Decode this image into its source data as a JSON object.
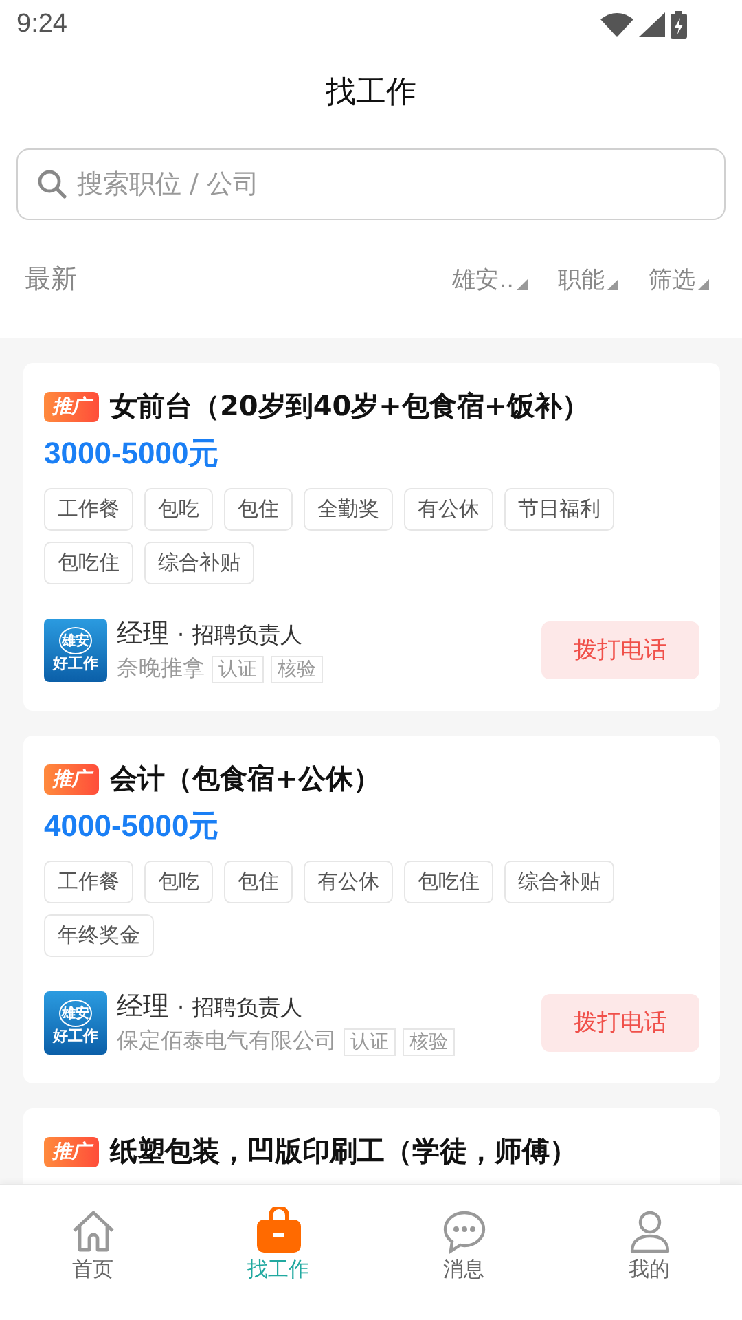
{
  "status_bar": {
    "time": "9:24"
  },
  "header": {
    "title": "找工作"
  },
  "search": {
    "placeholder": "搜索职位 / 公司"
  },
  "filters": {
    "sort": "最新",
    "dropdowns": [
      "雄安..",
      "职能",
      "筛选"
    ]
  },
  "jobs": [
    {
      "badge": "推广",
      "title": "女前台（20岁到40岁+包食宿+饭补）",
      "salary": "3000-5000元",
      "tags": [
        "工作餐",
        "包吃",
        "包住",
        "全勤奖",
        "有公休",
        "节日福利",
        "包吃住",
        "综合补贴"
      ],
      "logo_top": "雄安",
      "logo_bottom": "好工作",
      "contact": "经理",
      "dot": "·",
      "role": "招聘负责人",
      "company": "奈晚推拿",
      "marks": [
        "认证",
        "核验"
      ],
      "call": "拨打电话"
    },
    {
      "badge": "推广",
      "title": "会计（包食宿+公休）",
      "salary": "4000-5000元",
      "tags": [
        "工作餐",
        "包吃",
        "包住",
        "有公休",
        "包吃住",
        "综合补贴",
        "年终奖金"
      ],
      "logo_top": "雄安",
      "logo_bottom": "好工作",
      "contact": "经理",
      "dot": "·",
      "role": "招聘负责人",
      "company": "保定佰泰电气有限公司",
      "marks": [
        "认证",
        "核验"
      ],
      "call": "拨打电话"
    },
    {
      "badge": "推广",
      "title": "纸塑包装，凹版印刷工（学徒，师傅）"
    }
  ],
  "nav": [
    {
      "label": "首页",
      "selected": false
    },
    {
      "label": "找工作",
      "selected": true
    },
    {
      "label": "消息",
      "selected": false
    },
    {
      "label": "我的",
      "selected": false
    }
  ]
}
